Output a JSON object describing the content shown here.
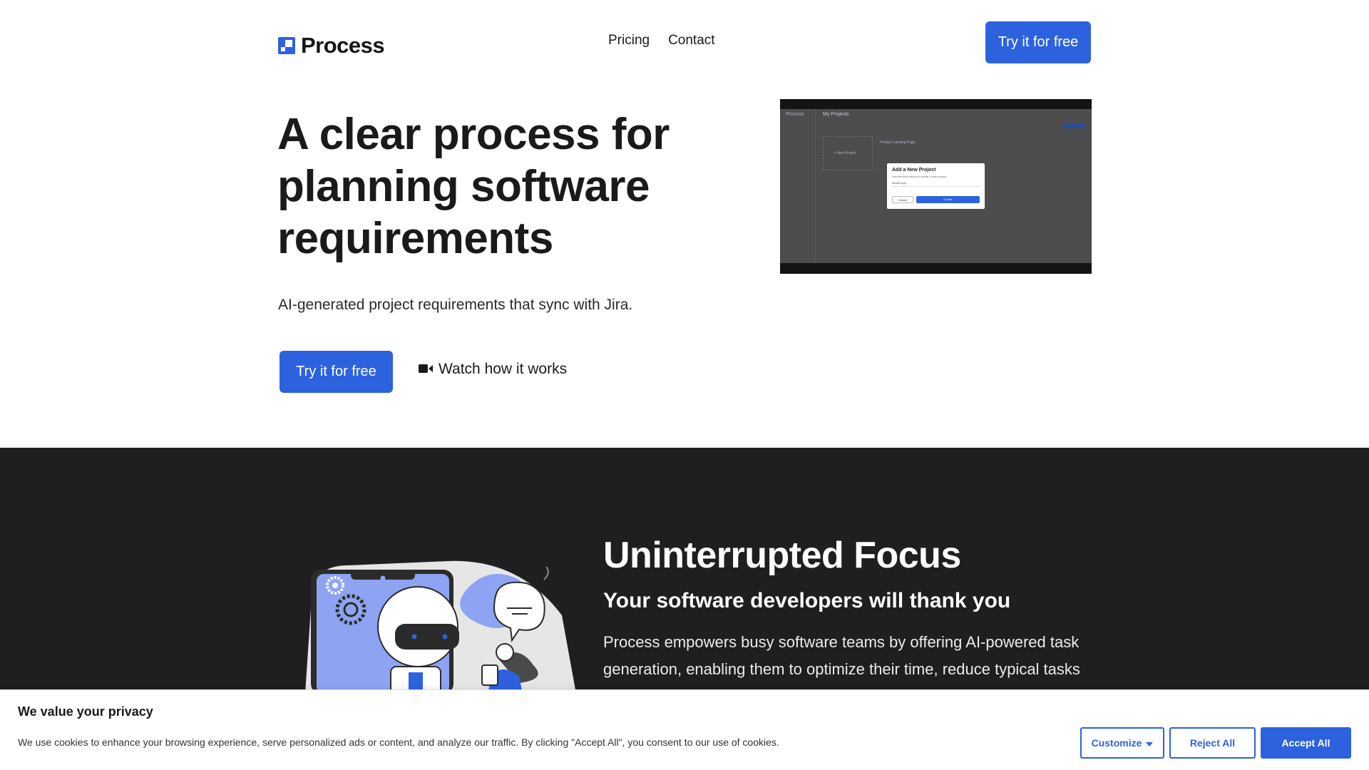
{
  "header": {
    "logo_text": "Process",
    "nav": [
      "Pricing",
      "Contact"
    ],
    "cta_label": "Try it for free"
  },
  "hero": {
    "title": "A clear process for planning software requirements",
    "subtitle": "AI-generated project requirements that sync with Jira.",
    "cta_label": "Try it for free",
    "watch_label": "Watch how it works",
    "video": {
      "app_name": "Process",
      "page_title": "My Projects",
      "new_project_label": "+ New Project",
      "project_card_title": "Product Landing Page",
      "modal_title": "Add a New Project",
      "modal_note": "Use the form below to create a new project.",
      "modal_input_value": "Mobile App",
      "modal_cancel": "Cancel",
      "modal_confirm": "Create"
    }
  },
  "feature": {
    "title": "Uninterrupted Focus",
    "subtitle": "Your software developers will thank you",
    "body": "Process empowers busy software teams by offering AI-powered task generation, enabling them to optimize their time, reduce typical tasks"
  },
  "cookie": {
    "title": "We value your privacy",
    "text": "We use cookies to enhance your browsing experience, serve personalized ads or content, and analyze our traffic. By clicking \"Accept All\", you consent to our use of cookies.",
    "customize_label": "Customize",
    "reject_label": "Reject All",
    "accept_label": "Accept All"
  },
  "colors": {
    "accent": "#2d62de",
    "dark_bg": "#1f1f1f",
    "illustration_blue": "#8ea4f2"
  }
}
